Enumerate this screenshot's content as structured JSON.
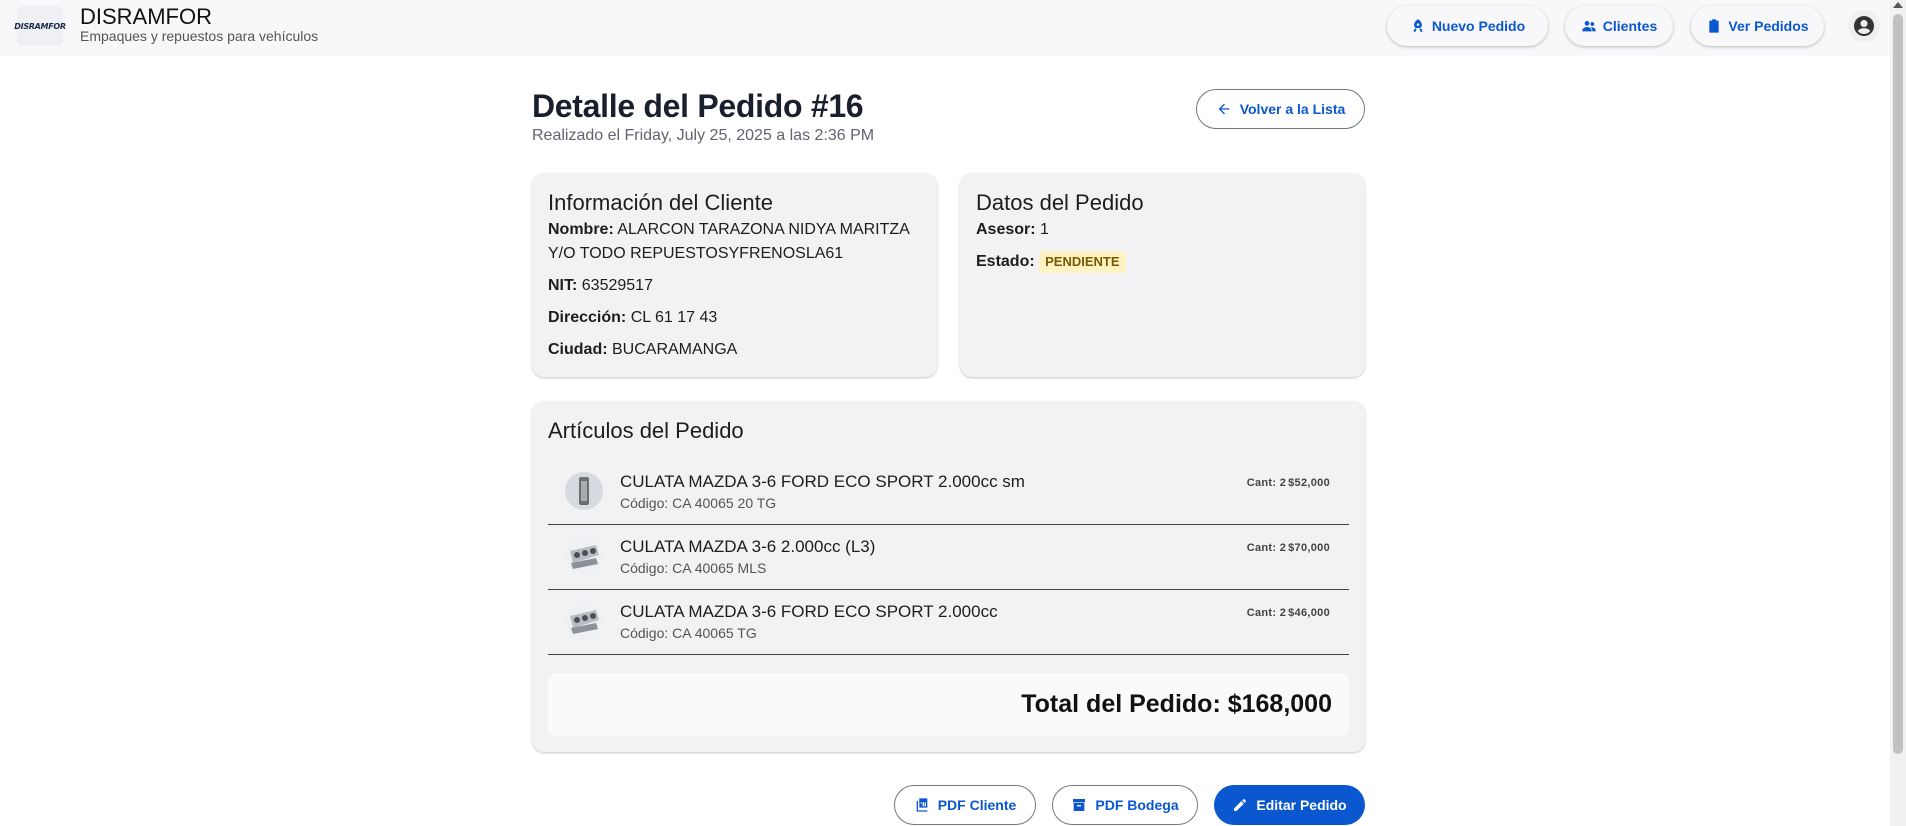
{
  "header": {
    "logo_text": "DISRAMFOR",
    "brand_name": "DISRAMFOR",
    "brand_subtitle": "Empaques y repuestos para vehículos",
    "nav": {
      "nuevo_pedido": "Nuevo Pedido",
      "clientes": "Clientes",
      "ver_pedidos": "Ver Pedidos"
    }
  },
  "page": {
    "title": "Detalle del Pedido #16",
    "date": "Realizado el Friday, July 25, 2025 a las 2:36 PM",
    "back_label": "Volver a la Lista"
  },
  "cliente": {
    "title": "Información del Cliente",
    "nombre_label": "Nombre:",
    "nombre": "ALARCON TARAZONA NIDYA MARITZA",
    "nombre_line2": "Y/O TODO REPUESTOSYFRENOSLA61",
    "nit_label": "NIT:",
    "nit": "63529517",
    "direccion_label": "Dirección:",
    "direccion": "CL 61 17 43",
    "ciudad_label": "Ciudad:",
    "ciudad": "BUCARAMANGA"
  },
  "pedido": {
    "title": "Datos del Pedido",
    "asesor_label": "Asesor:",
    "asesor": "1",
    "estado_label": "Estado:",
    "estado": "PENDIENTE"
  },
  "articulos": {
    "title": "Artículos del Pedido",
    "items": [
      {
        "name": "CULATA MAZDA 3-6 FORD ECO SPORT 2.000cc sm",
        "code": "Código: CA 40065 20 TG",
        "qty": "Cant: 2",
        "price": "$52,000"
      },
      {
        "name": "CULATA MAZDA 3-6 2.000cc (L3)",
        "code": "Código: CA 40065 MLS",
        "qty": "Cant: 2",
        "price": "$70,000"
      },
      {
        "name": "CULATA MAZDA 3-6 FORD ECO SPORT 2.000cc",
        "code": "Código: CA 40065 TG",
        "qty": "Cant: 2",
        "price": "$46,000"
      }
    ],
    "total": "Total del Pedido: $168,000"
  },
  "actions": {
    "pdf_cliente": "PDF Cliente",
    "pdf_bodega": "PDF Bodega",
    "editar": "Editar Pedido"
  },
  "colors": {
    "primary": "#0b57d0",
    "card_bg": "#f2f2f4",
    "badge_bg": "#fff3c4",
    "badge_text": "#7a5a00"
  },
  "icons": {
    "nuevo_pedido": "rocket-icon",
    "clientes": "people-icon",
    "ver_pedidos": "clipboard-icon",
    "account": "account-circle-icon",
    "back": "arrow-left-icon",
    "pdf_cliente": "pdf-icon",
    "pdf_bodega": "archive-box-icon",
    "editar": "pencil-icon"
  }
}
